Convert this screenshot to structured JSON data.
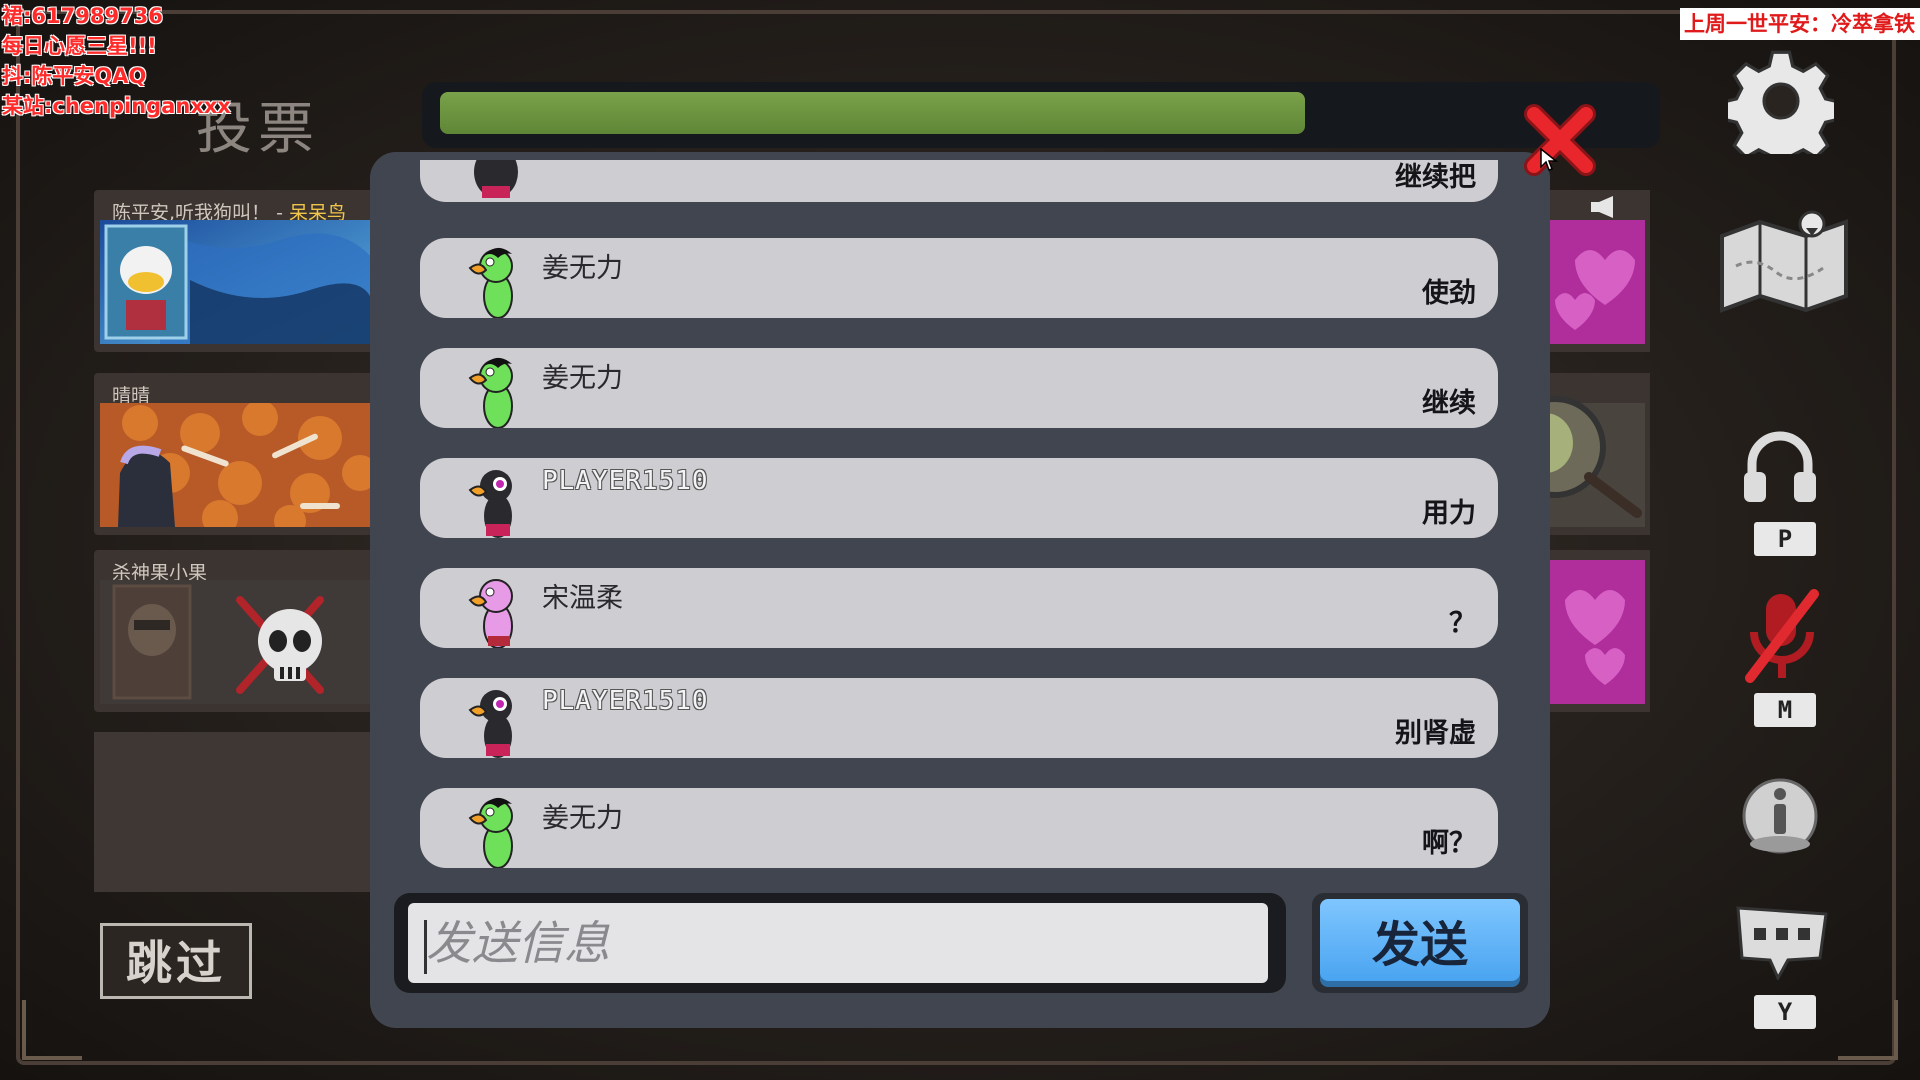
{
  "overlay": {
    "line1": "裙:617989736",
    "line2": "每日心愿三星!!!",
    "line3": "抖:陈平安QAQ",
    "line4": "某站:chenpinganxxx",
    "top_right": "上周一世平安：冷萃拿铁"
  },
  "meeting": {
    "title": "投票",
    "timer_progress": 0.72,
    "skip_label": "跳过"
  },
  "players": [
    {
      "name": "陈平安,听我狗叫！ - ",
      "name_highlight": "呆呆鸟",
      "status": "alive"
    },
    {
      "name": "晴晴",
      "name_highlight": "",
      "status": "alive"
    },
    {
      "name": "杀神果小果",
      "name_highlight": "",
      "status": "dead"
    }
  ],
  "chat": {
    "messages": [
      {
        "author": "",
        "text": "继续把",
        "color": "#2a2a2e",
        "latin": false
      },
      {
        "author": "姜无力",
        "text": "使劲",
        "color": "#6fe05a",
        "latin": false
      },
      {
        "author": "姜无力",
        "text": "继续",
        "color": "#6fe05a",
        "latin": false
      },
      {
        "author": "PLAYER1510",
        "text": "用力",
        "color": "#2a2a2e",
        "latin": true
      },
      {
        "author": "宋温柔",
        "text": "？",
        "color": "#e79be6",
        "latin": false
      },
      {
        "author": "PLAYER1510",
        "text": "别肾虚",
        "color": "#2a2a2e",
        "latin": true
      },
      {
        "author": "姜无力",
        "text": "啊？",
        "color": "#6fe05a",
        "latin": false
      }
    ],
    "input_placeholder": "发送信息",
    "send_label": "发送"
  },
  "sidebar": {
    "settings_icon": "gear-icon",
    "map_icon": "map-icon",
    "headphones_key": "P",
    "mic_key": "M",
    "chat_key": "Y"
  },
  "colors": {
    "accent_blue": "#4aa4f0",
    "timer_green": "#6a9440",
    "close_red": "#e8262c",
    "panel_bg": "#41454f"
  }
}
